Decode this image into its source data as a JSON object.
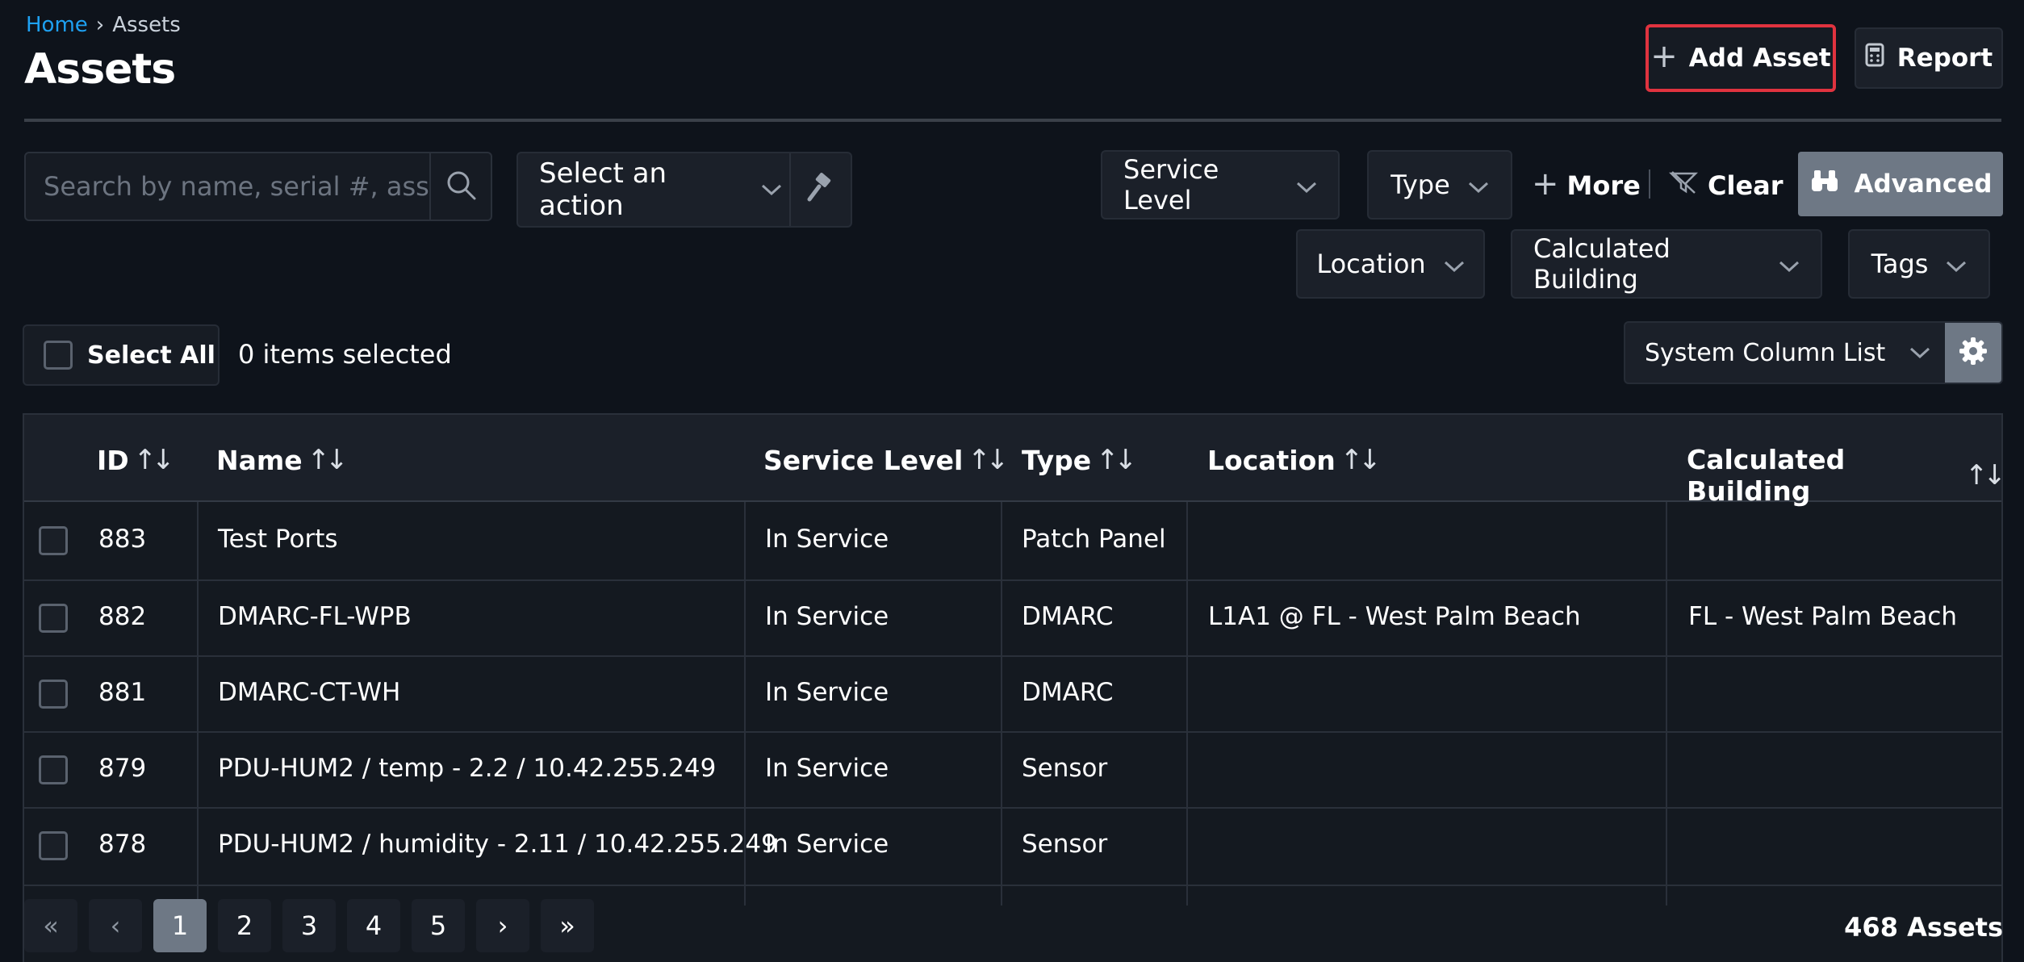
{
  "breadcrumb": {
    "home": "Home",
    "separator": "›",
    "current": "Assets"
  },
  "page_title": "Assets",
  "header_buttons": {
    "add_asset": "Add Asset",
    "report": "Report"
  },
  "search": {
    "placeholder": "Search by name, serial #, asset #"
  },
  "action_select": {
    "selected": "Select an action"
  },
  "filters": {
    "service_level": "Service Level",
    "type": "Type",
    "more": "More",
    "clear": "Clear",
    "advanced": "Advanced",
    "location": "Location",
    "calculated_building": "Calculated Building",
    "tags": "Tags"
  },
  "selection": {
    "select_all": "Select All",
    "items_selected": "0 items selected"
  },
  "column_list": {
    "selected": "System Column List"
  },
  "table": {
    "headers": [
      "ID",
      "Name",
      "Service Level",
      "Type",
      "Location",
      "Calculated Building"
    ],
    "rows": [
      {
        "id": "883",
        "name": "Test Ports",
        "service_level": "In Service",
        "type": "Patch Panel",
        "location": "",
        "building": ""
      },
      {
        "id": "882",
        "name": "DMARC-FL-WPB",
        "service_level": "In Service",
        "type": "DMARC",
        "location": "L1A1 @ FL - West Palm Beach",
        "building": "FL - West Palm Beach"
      },
      {
        "id": "881",
        "name": "DMARC-CT-WH",
        "service_level": "In Service",
        "type": "DMARC",
        "location": "",
        "building": ""
      },
      {
        "id": "879",
        "name": "PDU-HUM2 / temp - 2.2 / 10.42.255.249",
        "service_level": "In Service",
        "type": "Sensor",
        "location": "",
        "building": ""
      },
      {
        "id": "878",
        "name": "PDU-HUM2 / humidity - 2.11 / 10.42.255.249",
        "service_level": "In Service",
        "type": "Sensor",
        "location": "",
        "building": ""
      }
    ]
  },
  "pagination": {
    "pages": [
      "1",
      "2",
      "3",
      "4",
      "5"
    ],
    "current": "1",
    "total": "468 Assets"
  },
  "colors": {
    "accent_link": "#1ea1f2",
    "highlight_border": "#e0333f",
    "active_button": "#6e7885",
    "background": "#0e131b"
  }
}
